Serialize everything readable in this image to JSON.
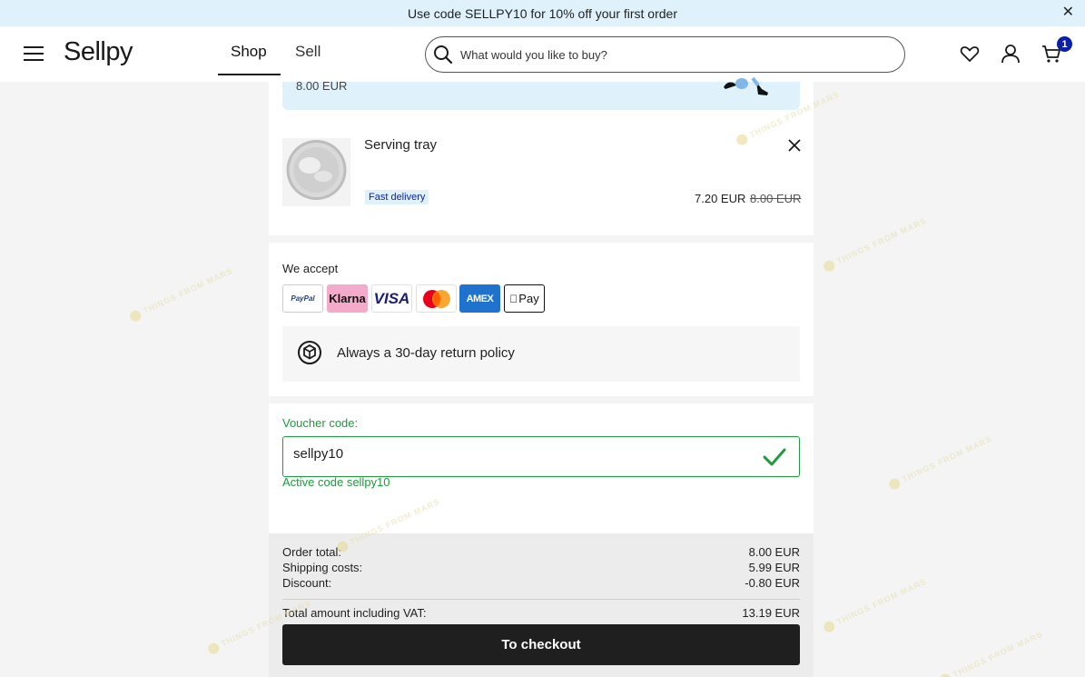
{
  "promo": {
    "text": "Use code SELLPY10 for 10% off your first order",
    "close_icon": "close-icon"
  },
  "header": {
    "logo": "Sellpy",
    "tabs": [
      {
        "label": "Shop",
        "active": true
      },
      {
        "label": "Sell",
        "active": false
      }
    ],
    "search_placeholder": "What would you like to buy?",
    "cart_count": "1",
    "icons": [
      "menu-icon",
      "search-icon",
      "heart-icon",
      "user-icon",
      "cart-icon"
    ]
  },
  "top_banner": {
    "price": "8.00 EUR"
  },
  "item": {
    "title": "Serving tray",
    "badge": "Fast delivery",
    "price_now": "7.20 EUR",
    "price_old": "8.00 EUR"
  },
  "payments": {
    "title": "We accept",
    "methods": [
      "PayPal",
      "Klarna",
      "VISA",
      "Mastercard",
      "AMEX",
      "Pay"
    ]
  },
  "return_policy": {
    "text": "Always a 30-day return policy"
  },
  "voucher": {
    "label": "Voucher code:",
    "value": "sellpy10",
    "status": "Active code sellpy10"
  },
  "summary": {
    "rows": [
      {
        "label": "Order total:",
        "value": "8.00 EUR"
      },
      {
        "label": "Shipping costs:",
        "value": "5.99 EUR"
      },
      {
        "label": "Discount:",
        "value": "-0.80 EUR"
      }
    ],
    "total_label": "Total amount including VAT:",
    "total_value": "13.19 EUR"
  },
  "checkout": {
    "label": "To checkout"
  },
  "watermark": {
    "text": "THINGS FROM MARS"
  },
  "colors": {
    "accent_blue": "#0d1fa6",
    "success_green": "#1e9b3b",
    "banner_blue": "#dff2fb",
    "dark_button": "#1f1f1f"
  }
}
